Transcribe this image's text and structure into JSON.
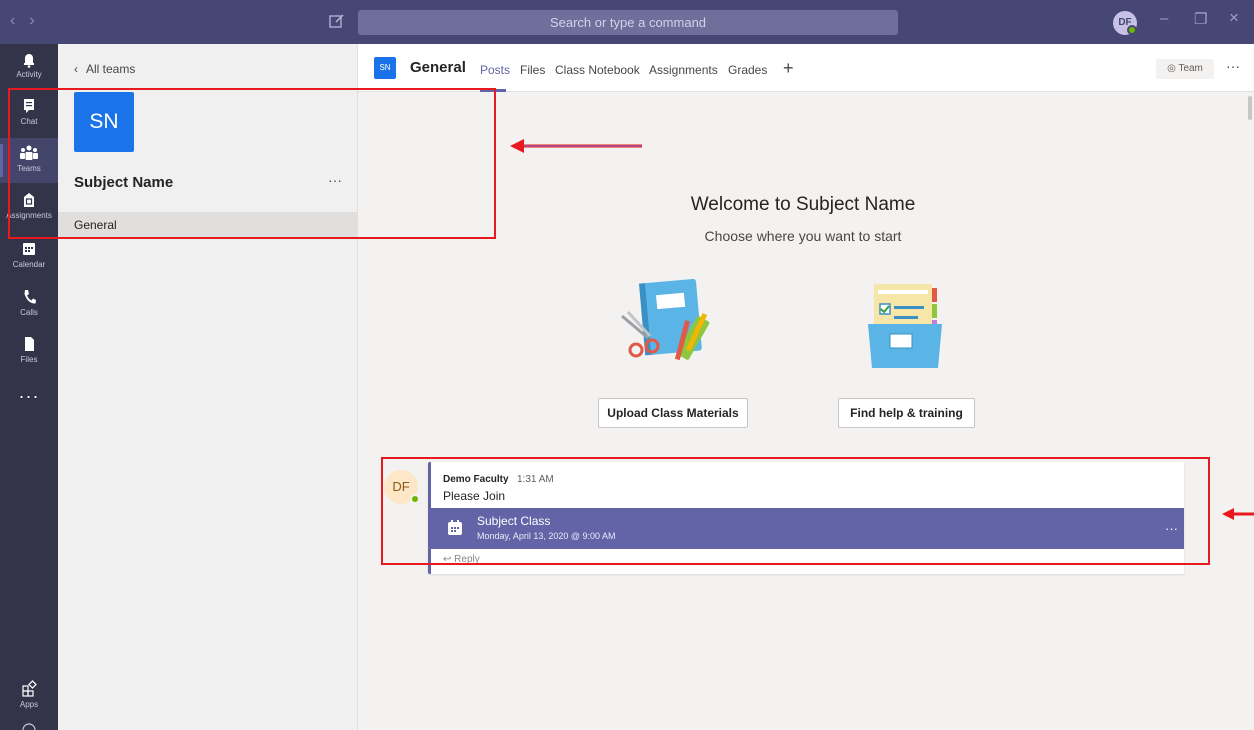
{
  "topbar": {
    "search_placeholder": "Search or type a command",
    "avatar_initials": "DF",
    "minimize_glyph": "–",
    "restore_glyph": "❐",
    "close_glyph": "×"
  },
  "rail": {
    "items": [
      {
        "label": "Activity",
        "icon": "bell-icon"
      },
      {
        "label": "Chat",
        "icon": "chat-icon"
      },
      {
        "label": "Teams",
        "icon": "teams-icon"
      },
      {
        "label": "Assignments",
        "icon": "assignments-icon"
      },
      {
        "label": "Calendar",
        "icon": "calendar-icon"
      },
      {
        "label": "Calls",
        "icon": "phone-icon"
      },
      {
        "label": "Files",
        "icon": "files-icon"
      }
    ],
    "more": "···",
    "apps_label": "Apps"
  },
  "team_panel": {
    "back_label": "All teams",
    "team_initials": "SN",
    "team_name": "Subject Name",
    "more": "···",
    "channels": [
      {
        "label": "General"
      }
    ]
  },
  "channel_header": {
    "avatar_initials": "SN",
    "title": "General",
    "tabs": [
      {
        "label": "Posts",
        "active": true
      },
      {
        "label": "Files"
      },
      {
        "label": "Class Notebook"
      },
      {
        "label": "Assignments"
      },
      {
        "label": "Grades"
      }
    ],
    "add_tab": "+",
    "team_button": "Team",
    "more": "···"
  },
  "welcome": {
    "title": "Welcome to Subject Name",
    "subtitle": "Choose where you want to start",
    "actions": [
      {
        "label": "Upload Class Materials"
      },
      {
        "label": "Find help & training"
      }
    ]
  },
  "post": {
    "avatar_initials": "DF",
    "author": "Demo Faculty",
    "time": "1:31 AM",
    "text": "Please Join",
    "meeting": {
      "title": "Subject Class",
      "date": "Monday, April 13, 2020 @ 9:00 AM",
      "more": "···"
    },
    "reply_label": "Reply"
  },
  "colors": {
    "brand_purple": "#6264a7",
    "titlebar": "#464775",
    "rail": "#33344a",
    "team_blue": "#1a73e8",
    "annotation_red": "#e8191f"
  }
}
